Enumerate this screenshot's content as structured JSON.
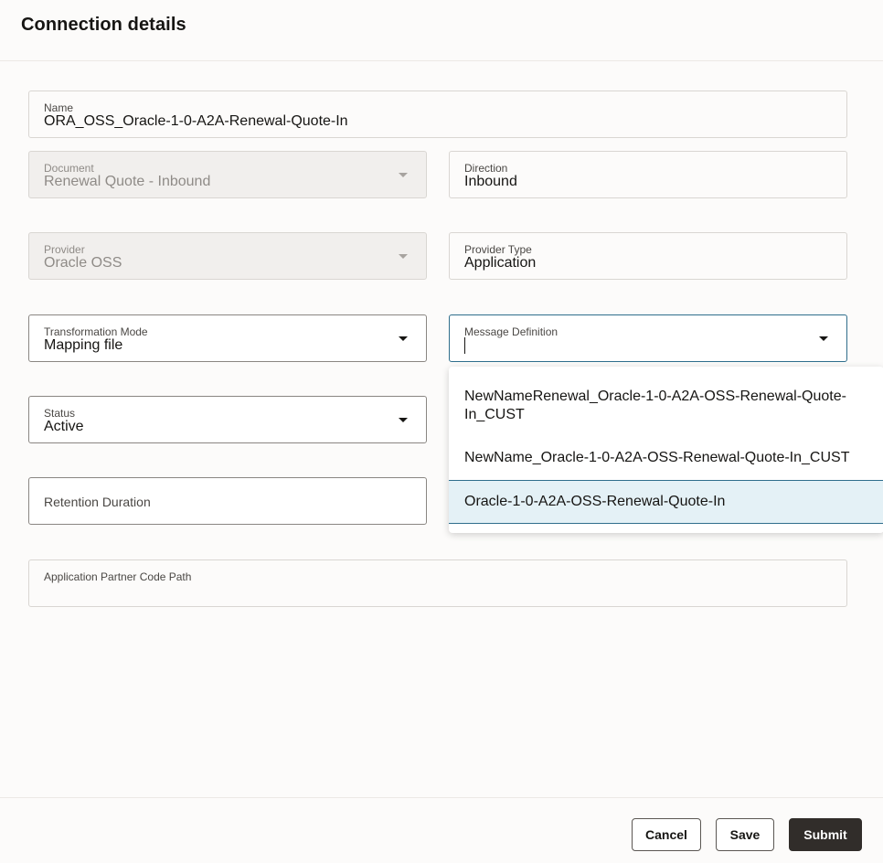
{
  "header": {
    "title": "Connection details"
  },
  "fields": {
    "name": {
      "label": "Name",
      "value": "ORA_OSS_Oracle-1-0-A2A-Renewal-Quote-In"
    },
    "document": {
      "label": "Document",
      "value": "Renewal Quote - Inbound"
    },
    "direction": {
      "label": "Direction",
      "value": "Inbound"
    },
    "provider": {
      "label": "Provider",
      "value": "Oracle OSS"
    },
    "provider_type": {
      "label": "Provider Type",
      "value": "Application"
    },
    "transformation_mode": {
      "label": "Transformation Mode",
      "value": "Mapping file"
    },
    "message_definition": {
      "label": "Message Definition",
      "value": ""
    },
    "status": {
      "label": "Status",
      "value": "Active"
    },
    "retention_duration": {
      "label": "Retention Duration"
    },
    "application_partner_code_path": {
      "label": "Application Partner Code Path",
      "value": ""
    }
  },
  "message_definition_options": [
    "NewNameRenewal_Oracle-1-0-A2A-OSS-Renewal-Quote-In_CUST",
    "NewName_Oracle-1-0-A2A-OSS-Renewal-Quote-In_CUST",
    "Oracle-1-0-A2A-OSS-Renewal-Quote-In"
  ],
  "footer": {
    "cancel_label": "Cancel",
    "save_label": "Save",
    "submit_label": "Submit"
  },
  "icons": {
    "dropdown": "chevron-down-icon"
  },
  "colors": {
    "primary_button": "#312d2a",
    "focus_border": "#2f6e8c",
    "selected_option_bg": "#e4f1f6"
  }
}
